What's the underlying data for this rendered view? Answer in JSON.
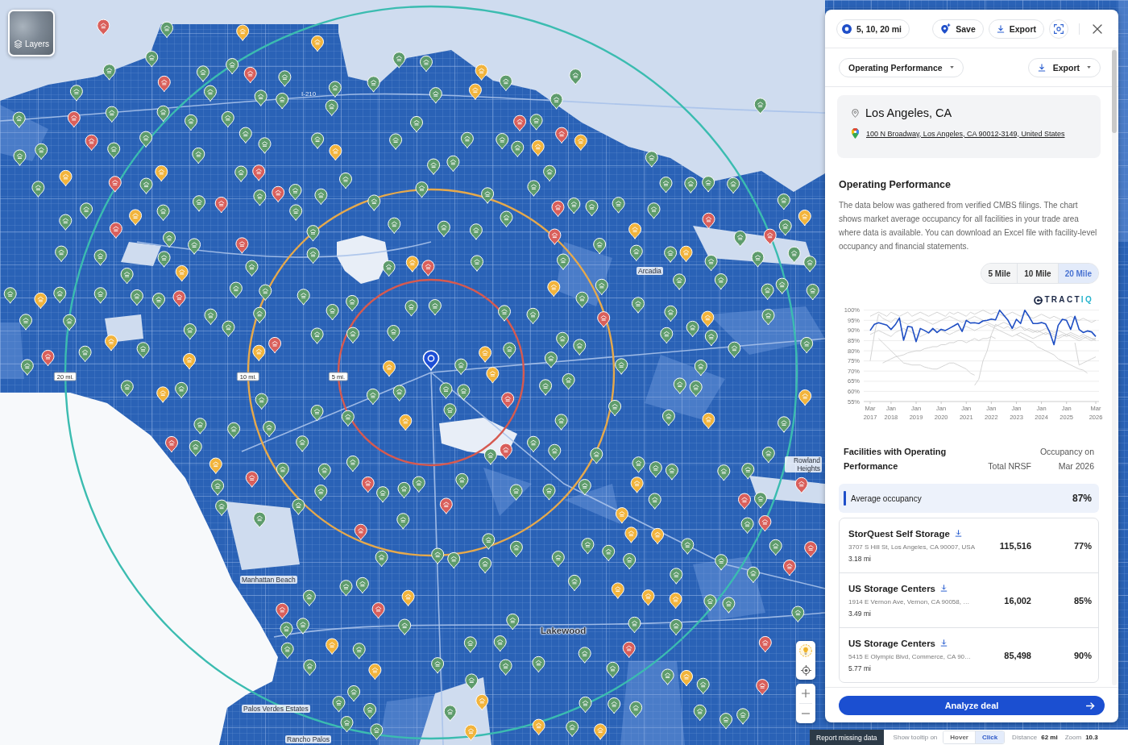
{
  "map": {
    "layers_button": {
      "label": "Layers"
    },
    "rings": [
      {
        "label": "20 mi.",
        "color": "#3bbcb0"
      },
      {
        "label": "10 mi.",
        "color": "#e6a94c"
      },
      {
        "label": "5 mi.",
        "color": "#d65a50"
      }
    ],
    "places": [
      {
        "label": "I-210",
        "kind": "road"
      },
      {
        "label": "Arcadia",
        "kind": "town"
      },
      {
        "label": "Rowland Heights",
        "kind": "town"
      },
      {
        "label": "Manhattan Beach",
        "kind": "town"
      },
      {
        "label": "Palos Verdes Estates",
        "kind": "town"
      },
      {
        "label": "Rancho Palos",
        "kind": "town"
      },
      {
        "label": "Lakewood",
        "kind": "city"
      }
    ]
  },
  "panel": {
    "radius_chip": {
      "label": "5, 10, 20 mi"
    },
    "actions": [
      {
        "label": "Save",
        "kind": "save"
      },
      {
        "label": "Export",
        "kind": "export"
      }
    ],
    "report_dropdown": {
      "label": "Operating Performance"
    },
    "export_dropdown": {
      "label": "Export"
    },
    "location": {
      "title": "Los Angeles, CA",
      "address": "100 N Broadway, Los Angeles, CA 90012-3149, United States"
    },
    "section_title": "Operating Performance",
    "description": "The data below was gathered from verified CMBS filings. The chart shows market average occupancy for all facilities in your trade area where data is available. You can download an Excel file with facility-level occupancy and financial statements.",
    "radius_tabs": [
      {
        "label": "5 Mile",
        "selected": false
      },
      {
        "label": "10 Mile",
        "selected": false
      },
      {
        "label": "20 Mile",
        "selected": true
      }
    ],
    "logo": {
      "prefix": "TRACT",
      "suffix": "IQ"
    },
    "chart_data": {
      "type": "line",
      "grid": true,
      "categories": [
        "Mar 2017",
        null,
        null,
        null,
        null,
        "Jan 2018",
        null,
        null,
        null,
        null,
        null,
        "Jan 2019",
        null,
        null,
        null,
        null,
        null,
        "Jan 2020",
        null,
        null,
        null,
        null,
        null,
        "Jan 2021",
        null,
        null,
        null,
        null,
        null,
        "Jan 2022",
        null,
        null,
        null,
        null,
        null,
        "Jan 2023",
        null,
        null,
        null,
        null,
        null,
        "Jan 2024",
        null,
        null,
        null,
        null,
        null,
        "Jan 2025",
        null,
        null,
        null,
        null,
        null,
        null,
        "Mar 2026"
      ],
      "ylim": [
        55,
        100
      ],
      "yticks": [
        {
          "value": 100,
          "label": "100%"
        },
        {
          "value": 95,
          "label": "95%"
        },
        {
          "value": 90,
          "label": "90%"
        },
        {
          "value": 85,
          "label": "85%"
        },
        {
          "value": 80,
          "label": "80%"
        },
        {
          "value": 75,
          "label": "75%"
        },
        {
          "value": 70,
          "label": "70%"
        },
        {
          "value": 65,
          "label": "65%"
        },
        {
          "value": 60,
          "label": "60%"
        },
        {
          "value": 55,
          "label": "55%"
        }
      ],
      "series": [
        {
          "color": "#1f4fc4",
          "values": [
            90,
            93,
            93.8,
            93.2,
            92.6,
            90.5,
            92.8,
            96.2,
            85.2,
            92,
            91.6,
            84.5,
            91,
            90,
            88.8,
            91,
            89,
            90.6,
            90,
            91.1,
            92.2,
            93.4,
            89.5,
            95,
            93.7,
            93.8,
            93.4,
            94.7,
            95,
            95.6,
            95.2,
            100,
            97.5,
            95,
            91,
            95.5,
            93.4,
            100,
            97,
            93.4,
            93.4,
            93.9,
            93.2,
            89,
            83,
            92.5,
            95.5,
            95,
            90.5,
            97,
            90.5,
            89,
            89.8,
            89.3,
            87
          ]
        },
        {
          "color": "#cfcfcf",
          "values": [
            97,
            98,
            99,
            98,
            97,
            99,
            98,
            97,
            98,
            99,
            97,
            98,
            99,
            98,
            97,
            98,
            99,
            98,
            97,
            99,
            98,
            99,
            98,
            97,
            99,
            98,
            99,
            100,
            99,
            98,
            99,
            98,
            97,
            98,
            99,
            98,
            97,
            98,
            97,
            96,
            97,
            98,
            97,
            96,
            97,
            96,
            95,
            96,
            97,
            96,
            95,
            96,
            95,
            94,
            95
          ]
        },
        {
          "color": "#cfcfcf",
          "values": [
            88,
            89,
            90,
            89,
            88,
            87,
            89,
            90,
            91,
            90,
            89,
            88,
            87,
            88,
            89,
            90,
            91,
            90,
            89,
            88,
            89,
            90,
            91,
            92,
            91,
            90,
            91,
            92,
            93,
            92,
            91,
            90,
            89,
            88,
            87,
            88,
            89,
            88,
            87,
            86,
            87,
            88,
            89,
            88,
            87,
            86,
            87,
            88,
            87,
            86,
            85,
            86,
            87,
            86,
            85
          ]
        },
        {
          "color": "#cfcfcf",
          "values": [
            75,
            88,
            98,
            96,
            95,
            94,
            96,
            95,
            94,
            93,
            94,
            95,
            96,
            95,
            94,
            93,
            94,
            95,
            96,
            97,
            96,
            95,
            94,
            95,
            96,
            97,
            96,
            95,
            94,
            93,
            92,
            93,
            94,
            93,
            92,
            91,
            92,
            91,
            90,
            89,
            90,
            89,
            88,
            89,
            88,
            87,
            88,
            87,
            88,
            87,
            86,
            87,
            86,
            85,
            86
          ]
        },
        {
          "color": "#cfcfcf",
          "values": [
            null,
            null,
            86,
            84,
            82,
            80,
            78,
            76,
            74,
            73.5,
            73,
            73,
            73,
            72,
            71.5,
            71,
            71,
            72,
            73,
            74,
            74,
            73,
            72,
            71,
            69,
            68,
            null,
            null,
            null,
            null,
            null,
            null,
            null,
            null,
            null,
            null,
            null,
            null,
            null,
            null,
            null,
            null,
            null,
            null,
            null,
            null,
            null,
            null,
            null,
            null,
            null,
            null,
            null,
            null,
            null
          ]
        },
        {
          "color": "#cfcfcf",
          "values": [
            null,
            null,
            null,
            null,
            null,
            null,
            null,
            null,
            null,
            null,
            null,
            null,
            null,
            null,
            null,
            null,
            null,
            null,
            null,
            null,
            null,
            null,
            null,
            null,
            null,
            63,
            66,
            75,
            80,
            88,
            93,
            92,
            91,
            92,
            90,
            91,
            92,
            90,
            91,
            90,
            89,
            90,
            91,
            90,
            89,
            90,
            89,
            88,
            89,
            88,
            87,
            88,
            87,
            86,
            86
          ]
        },
        {
          "color": "#cfcfcf",
          "values": [
            null,
            null,
            null,
            null,
            null,
            null,
            null,
            null,
            null,
            null,
            null,
            null,
            null,
            null,
            null,
            null,
            null,
            null,
            null,
            null,
            null,
            null,
            null,
            null,
            null,
            null,
            null,
            null,
            null,
            null,
            null,
            null,
            null,
            null,
            null,
            88,
            87,
            86,
            85,
            84,
            82,
            81,
            80,
            79,
            78,
            76,
            75,
            74,
            73,
            72,
            71,
            70.5,
            69,
            null,
            null
          ]
        },
        {
          "color": "#cfcfcf",
          "values": [
            null,
            null,
            null,
            74,
            75,
            76,
            77,
            77.5,
            78,
            79,
            79.5,
            80,
            80,
            81,
            81.5,
            82,
            82,
            83,
            83,
            84,
            84,
            85,
            85,
            84,
            85,
            86,
            85,
            86,
            86,
            87,
            86,
            null,
            null,
            null,
            null,
            null,
            null,
            null,
            null,
            null,
            null,
            null,
            null,
            null,
            null,
            null,
            null,
            null,
            null,
            null,
            null,
            null,
            null,
            null,
            null
          ]
        },
        {
          "color": "#cfcfcf",
          "values": [
            null,
            null,
            null,
            null,
            null,
            null,
            null,
            null,
            null,
            null,
            null,
            null,
            null,
            null,
            null,
            null,
            null,
            null,
            null,
            null,
            null,
            null,
            null,
            null,
            null,
            null,
            null,
            null,
            null,
            null,
            null,
            null,
            null,
            null,
            null,
            null,
            null,
            null,
            null,
            null,
            null,
            null,
            null,
            null,
            null,
            null,
            null,
            null,
            null,
            84,
            73,
            74,
            75,
            76,
            77
          ]
        }
      ]
    },
    "table": {
      "columns": [
        "Facilities with Operating Performance",
        "Total NRSF",
        "Occupancy on Mar 2026"
      ],
      "average": {
        "label": "Average occupancy",
        "value": "87%"
      },
      "rows": [
        {
          "name": "StorQuest Self Storage",
          "address": "3707 S Hill St, Los Angeles, CA 90007, USA",
          "distance": "3.18 mi",
          "nrsf": "115,516",
          "occupancy": "77%"
        },
        {
          "name": "US Storage Centers",
          "address": "1914 E Vernon Ave, Vernon, CA 90058, …",
          "distance": "3.49 mi",
          "nrsf": "16,002",
          "occupancy": "85%"
        },
        {
          "name": "US Storage Centers",
          "address": "5415 E Olympic Blvd, Commerce, CA 90…",
          "distance": "5.77 mi",
          "nrsf": "85,498",
          "occupancy": "90%"
        }
      ]
    },
    "primary_button": {
      "label": "Analyze deal"
    }
  },
  "status_bar": {
    "report_button": "Report missing data",
    "tooltip_label": "Show tooltip on",
    "tooltip_modes": [
      {
        "label": "Hover",
        "selected": false
      },
      {
        "label": "Click",
        "selected": true
      }
    ],
    "distance_label": "Distance",
    "distance": "62 mi",
    "zoom_label": "Zoom",
    "zoom": "10.3"
  }
}
